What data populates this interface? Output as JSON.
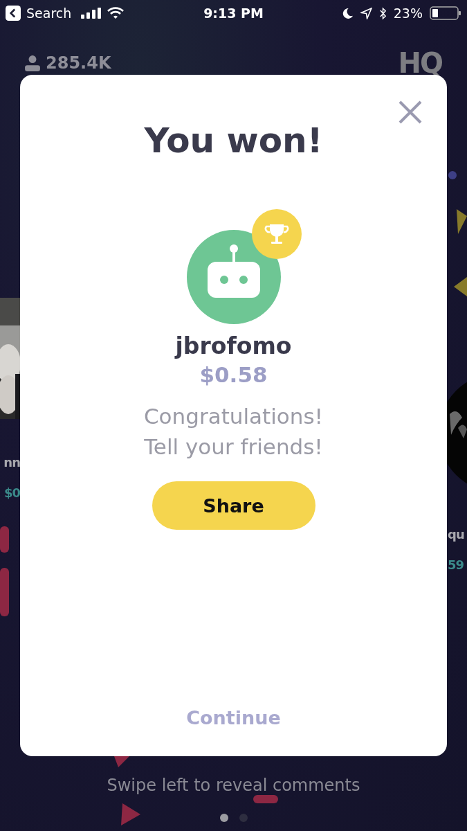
{
  "status_bar": {
    "back_label": "Search",
    "time": "9:13 PM",
    "battery": "23%"
  },
  "header": {
    "viewers": "285.4K",
    "logo": "HQ"
  },
  "side_left": {
    "name": "nn",
    "amount": "$0"
  },
  "side_right": {
    "name": "qu",
    "amount": "59"
  },
  "modal": {
    "title": "You won!",
    "username": "jbrofomo",
    "prize": "$0.58",
    "message": [
      "Congratulations!",
      "Tell your friends!"
    ],
    "share_button": "Share",
    "continue_button": "Continue"
  },
  "footer": {
    "hint": "Swipe left to reveal comments",
    "pages": [
      {
        "selected": true
      },
      {
        "selected": false
      }
    ]
  }
}
